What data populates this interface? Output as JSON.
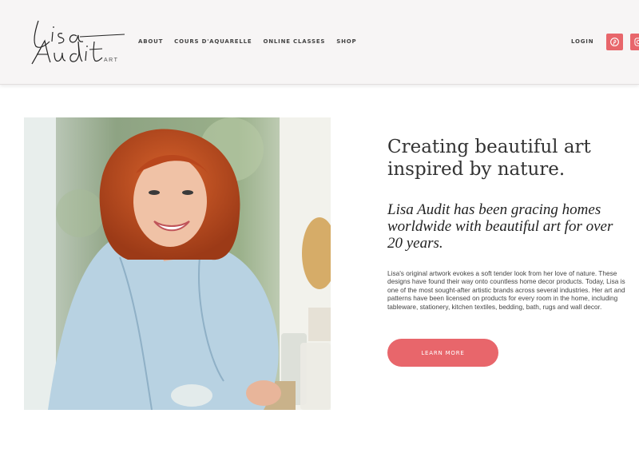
{
  "brand": {
    "logo_text": "Lisa Audit",
    "logo_sub": "ART"
  },
  "nav": {
    "items": [
      "ABOUT",
      "COURS D'AQUARELLE",
      "ONLINE CLASSES",
      "SHOP"
    ],
    "login": "LOGIN"
  },
  "social": {
    "icons": [
      "pinterest-icon",
      "instagram-icon"
    ],
    "accent": "#e8666b"
  },
  "hero": {
    "image_alt": "Portrait of Lisa Audit",
    "headline": "Creating beautiful art inspired by nature.",
    "subhead": "Lisa Audit has been gracing homes worldwide with beautiful art for over 20 years.",
    "body": "Lisa's original artwork evokes a soft tender look from her love of nature. These designs have found their way onto countless home decor products. Today, Lisa is one of the most sought-after artistic brands across several industries. Her art and patterns have been licensed on products for every room in the home, including tableware, stationery, kitchen textiles, bedding, bath, rugs and wall decor.",
    "cta_label": "LEARN MORE"
  }
}
